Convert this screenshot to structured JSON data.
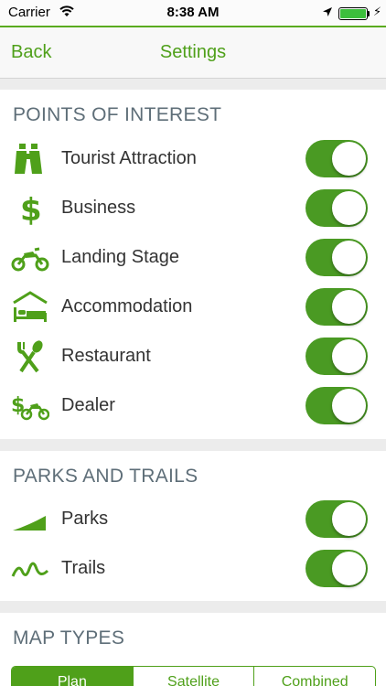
{
  "status_bar": {
    "carrier": "Carrier",
    "time": "8:38 AM"
  },
  "nav": {
    "back_label": "Back",
    "title": "Settings"
  },
  "points_of_interest": {
    "header": "POINTS OF INTEREST",
    "items": [
      {
        "label": "Tourist Attraction",
        "icon": "binoculars-icon",
        "enabled": true
      },
      {
        "label": "Business",
        "icon": "dollar-icon",
        "enabled": true
      },
      {
        "label": "Landing Stage",
        "icon": "motorbike-icon",
        "enabled": true
      },
      {
        "label": "Accommodation",
        "icon": "bed-icon",
        "enabled": true
      },
      {
        "label": "Restaurant",
        "icon": "cutlery-icon",
        "enabled": true
      },
      {
        "label": "Dealer",
        "icon": "dealer-icon",
        "enabled": true
      }
    ]
  },
  "parks_and_trails": {
    "header": "PARKS AND TRAILS",
    "items": [
      {
        "label": "Parks",
        "icon": "mountain-icon",
        "enabled": true
      },
      {
        "label": "Trails",
        "icon": "trail-icon",
        "enabled": true
      }
    ]
  },
  "map_types": {
    "header": "MAP TYPES",
    "options": [
      "Plan",
      "Satellite",
      "Combined"
    ],
    "selected": "Plan"
  },
  "colors": {
    "accent": "#4fa01a",
    "toggle_on": "#4a9a23",
    "section_header": "#5e6e78"
  }
}
